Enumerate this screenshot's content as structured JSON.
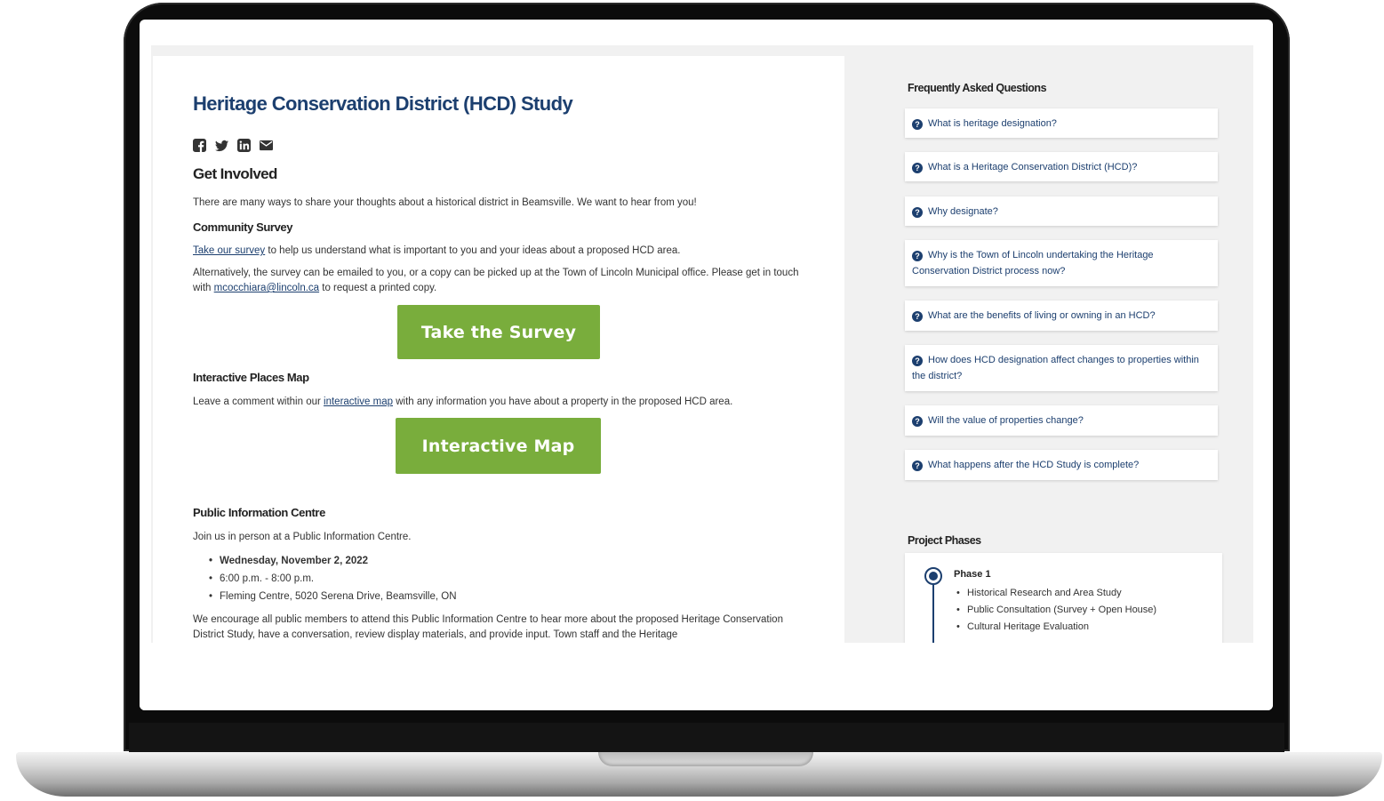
{
  "page": {
    "title": "Heritage Conservation District (HCD) Study"
  },
  "share": {
    "icons": [
      "facebook-icon",
      "twitter-icon",
      "linkedin-icon",
      "email-icon"
    ]
  },
  "get_involved": {
    "heading": "Get Involved",
    "intro": "There are many ways to share your thoughts about a historical district in Beamsville. We want to hear from you!"
  },
  "survey": {
    "heading": "Community Survey",
    "link_text": "Take our survey",
    "line1_rest": " to help us understand what is important to you and your ideas about a proposed HCD area.",
    "line2_a": "Alternatively, the survey can be emailed to you, or a copy can be picked up at the Town of Lincoln Municipal office. Please get in touch with ",
    "email": "mcocchiara@lincoln.ca",
    "line2_b": " to request a printed copy.",
    "button": "Take the Survey"
  },
  "map": {
    "heading": "Interactive Places Map",
    "line_a": "Leave a comment within our ",
    "link_text": "interactive map",
    "line_b": " with any information you have about a property in the proposed HCD area.",
    "button": "Interactive Map"
  },
  "pic": {
    "heading": "Public Information Centre",
    "intro": "Join us in person at a Public Information Centre.",
    "items": [
      "Wednesday, November 2, 2022",
      "6:00 p.m. - 8:00 p.m.",
      "Fleming Centre, 5020 Serena Drive, Beamsville, ON"
    ],
    "body": "We encourage all public members to attend this Public Information Centre to hear more about the proposed Heritage Conservation District Study, have a conversation, review display materials, and provide input. Town staff and the Heritage"
  },
  "faq": {
    "heading": "Frequently Asked Questions",
    "items": [
      "What is heritage designation?",
      "What is a Heritage Conservation District (HCD)?",
      "Why designate?",
      "Why is the Town of Lincoln undertaking the Heritage Conservation District process now?",
      "What are the benefits of living or owning in an HCD?",
      "How does HCD designation affect changes to properties within the district?",
      "Will the value of properties change?",
      "What happens after the HCD Study is complete?"
    ]
  },
  "phases": {
    "heading": "Project Phases",
    "phase1": {
      "title": "Phase 1",
      "items": [
        "Historical Research and Area Study",
        "Public Consultation (Survey + Open House)",
        "Cultural Heritage Evaluation"
      ]
    }
  },
  "colors": {
    "title_blue": "#1c3f6f",
    "button_green": "#79ad3c"
  }
}
